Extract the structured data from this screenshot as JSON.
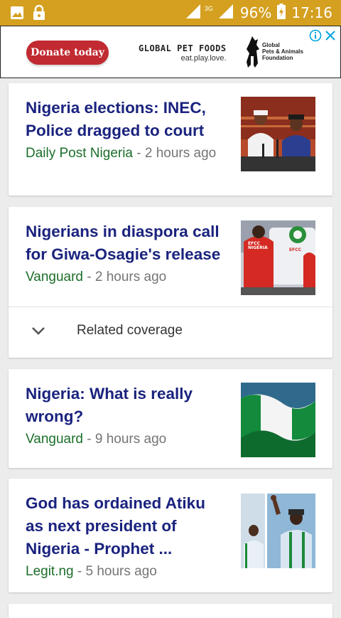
{
  "status_bar": {
    "network": "3G",
    "battery": "96%",
    "time": "17:16",
    "icons": [
      "image-icon",
      "lock-icon",
      "signal-icon",
      "battery-icon"
    ]
  },
  "ad": {
    "donate_label": "Donate today",
    "brand_name": "GLOBAL PET FOODS",
    "brand_tagline": "eat.play.love.",
    "foundation_line1": "Global",
    "foundation_line2": "Pets & Animals",
    "foundation_line3": "Foundation",
    "accent_color": "#c12a31",
    "icons": [
      "ad-info-icon",
      "ad-close-icon"
    ]
  },
  "articles": [
    {
      "headline": "Nigeria elections: INEC, Police dragged to court",
      "source": "Daily Post Nigeria",
      "time": "2 hours ago"
    },
    {
      "headline": "Nigerians in diaspora call for Giwa-Osagie's release",
      "source": "Vanguard",
      "time": "2 hours ago",
      "related_label": "Related coverage",
      "thumb_text_1": "EFCC\nNIGERIA",
      "thumb_text_2": "EFCC"
    },
    {
      "headline": "Nigeria: What is really wrong?",
      "source": "Vanguard",
      "time": "9 hours ago"
    },
    {
      "headline": "God has ordained Atiku as next president of Nigeria - Prophet ...",
      "source": "Legit.ng",
      "time": "5 hours ago"
    }
  ],
  "colors": {
    "status_bar": "#d5a020",
    "headline": "#1a237e",
    "source": "#1b6e2a",
    "meta": "#757575"
  }
}
